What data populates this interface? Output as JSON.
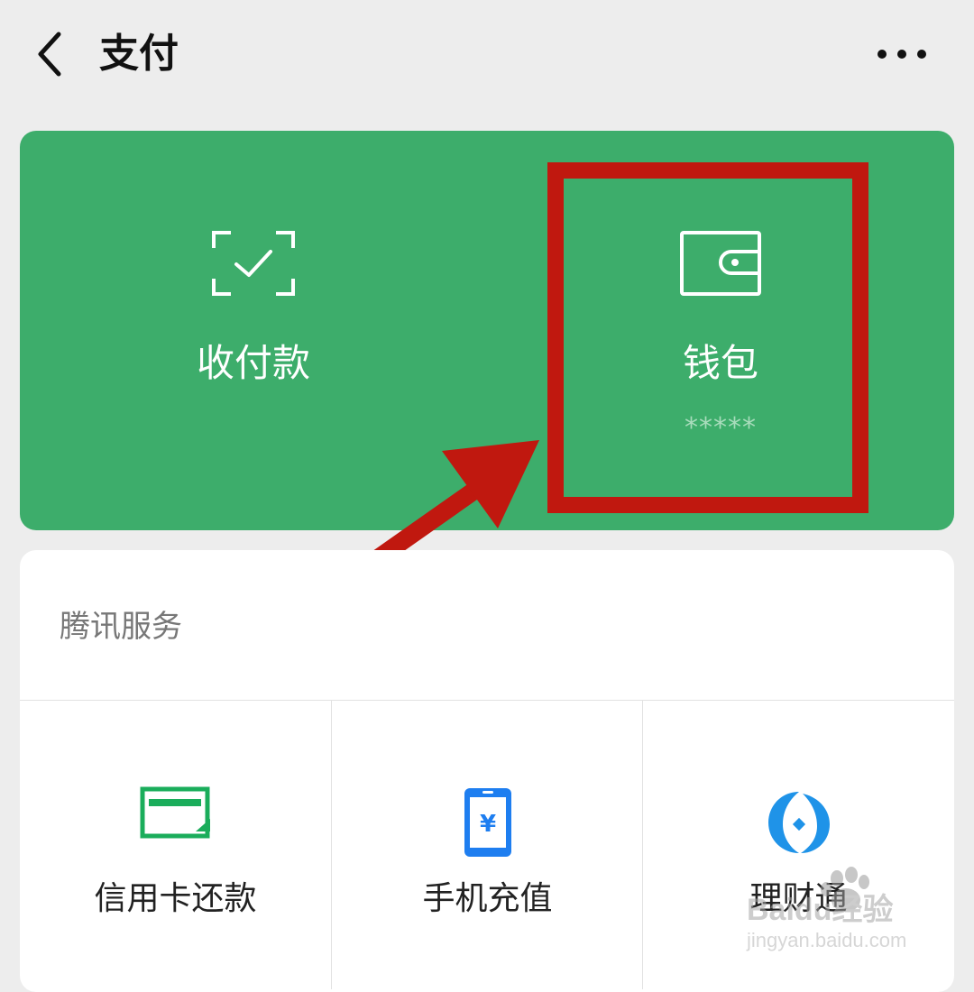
{
  "nav": {
    "title": "支付",
    "back_icon": "chevron-left-icon",
    "more_icon": "more-horizontal-icon"
  },
  "payment_card": {
    "background": "#3dad6b",
    "left": {
      "label": "收付款",
      "icon": "scan-check-icon"
    },
    "right": {
      "label": "钱包",
      "sub": "*****",
      "icon": "wallet-icon"
    }
  },
  "annotation": {
    "color": "#c0180f"
  },
  "services": {
    "title": "腾讯服务",
    "items": [
      {
        "label": "信用卡还款",
        "icon": "credit-card-icon",
        "color": "#1aad5b"
      },
      {
        "label": "手机充值",
        "icon": "phone-topup-icon",
        "color": "#1e7ef0"
      },
      {
        "label": "理财通",
        "icon": "licaitong-icon",
        "color": "#1f93e8"
      }
    ]
  },
  "watermark": {
    "brand": "Baidu经验",
    "url": "jingyan.baidu.com"
  }
}
